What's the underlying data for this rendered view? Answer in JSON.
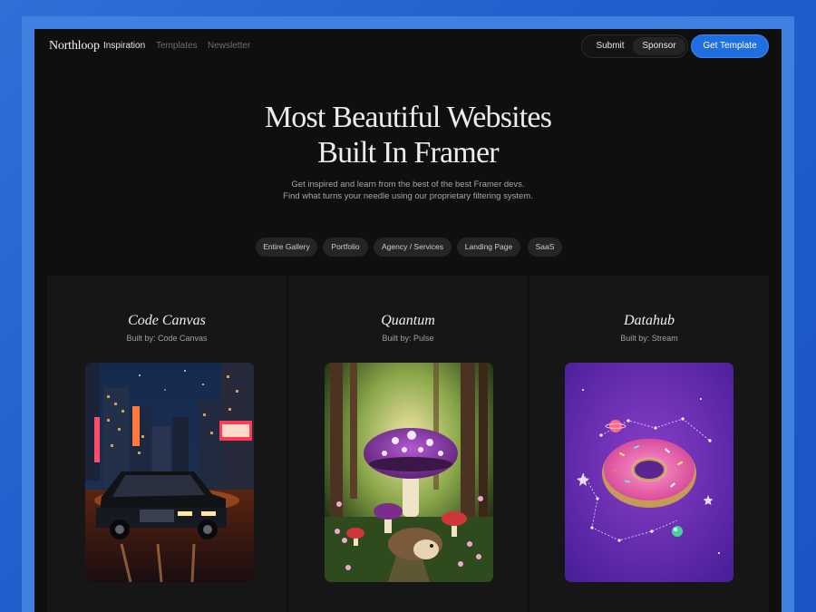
{
  "nav": {
    "logo": "Northloop",
    "links": [
      {
        "label": "Inspiration",
        "active": true
      },
      {
        "label": "Templates",
        "active": false
      },
      {
        "label": "Newsletter",
        "active": false
      }
    ],
    "submit_label": "Submit",
    "sponsor_label": "Sponsor",
    "cta_label": "Get Template"
  },
  "hero": {
    "title_line1": "Most Beautiful Websites",
    "title_line2": "Built In Framer",
    "subtitle_line1": "Get inspired and learn from the best of the best Framer devs.",
    "subtitle_line2": "Find what turns your needle using our proprietary filtering system."
  },
  "filters": [
    "Entire Gallery",
    "Portfolio",
    "Agency / Services",
    "Landing Page",
    "SaaS"
  ],
  "cards": [
    {
      "title": "Code Canvas",
      "builder": "Built by: Code Canvas",
      "image": "city-night-limousine"
    },
    {
      "title": "Quantum",
      "builder": "Built by: Pulse",
      "image": "forest-mushroom-hedgehog"
    },
    {
      "title": "Datahub",
      "builder": "Built by: Stream",
      "image": "space-donut"
    }
  ],
  "colors": {
    "accent": "#1f6fe0",
    "background": "#0f0f0f",
    "frame": "#2f6fd6"
  }
}
